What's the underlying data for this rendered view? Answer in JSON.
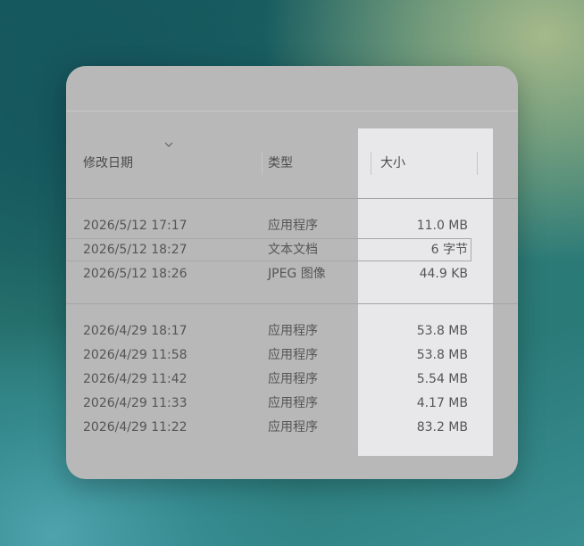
{
  "columns": {
    "modified": "修改日期",
    "type": "类型",
    "size": "大小"
  },
  "sort_icon": "chevron-down-icon",
  "groups": [
    {
      "rows": [
        {
          "date": "2026/5/12 17:17",
          "type": "应用程序",
          "size": "11.0 MB"
        },
        {
          "date": "2026/5/12 18:27",
          "type": "文本文档",
          "size": "6 字节"
        },
        {
          "date": "2026/5/12 18:26",
          "type": "JPEG 图像",
          "size": "44.9 KB"
        }
      ]
    },
    {
      "rows": [
        {
          "date": "2026/4/29 18:17",
          "type": "应用程序",
          "size": "53.8 MB"
        },
        {
          "date": "2026/4/29 11:58",
          "type": "应用程序",
          "size": "53.8 MB"
        },
        {
          "date": "2026/4/29 11:42",
          "type": "应用程序",
          "size": "5.54 MB"
        },
        {
          "date": "2026/4/29 11:33",
          "type": "应用程序",
          "size": "4.17 MB"
        },
        {
          "date": "2026/4/29 11:22",
          "type": "应用程序",
          "size": "83.2 MB"
        }
      ]
    }
  ],
  "colors": {
    "panel": "#b8b8b8",
    "column_highlight": "#e8e8eb",
    "text": "#555555"
  }
}
